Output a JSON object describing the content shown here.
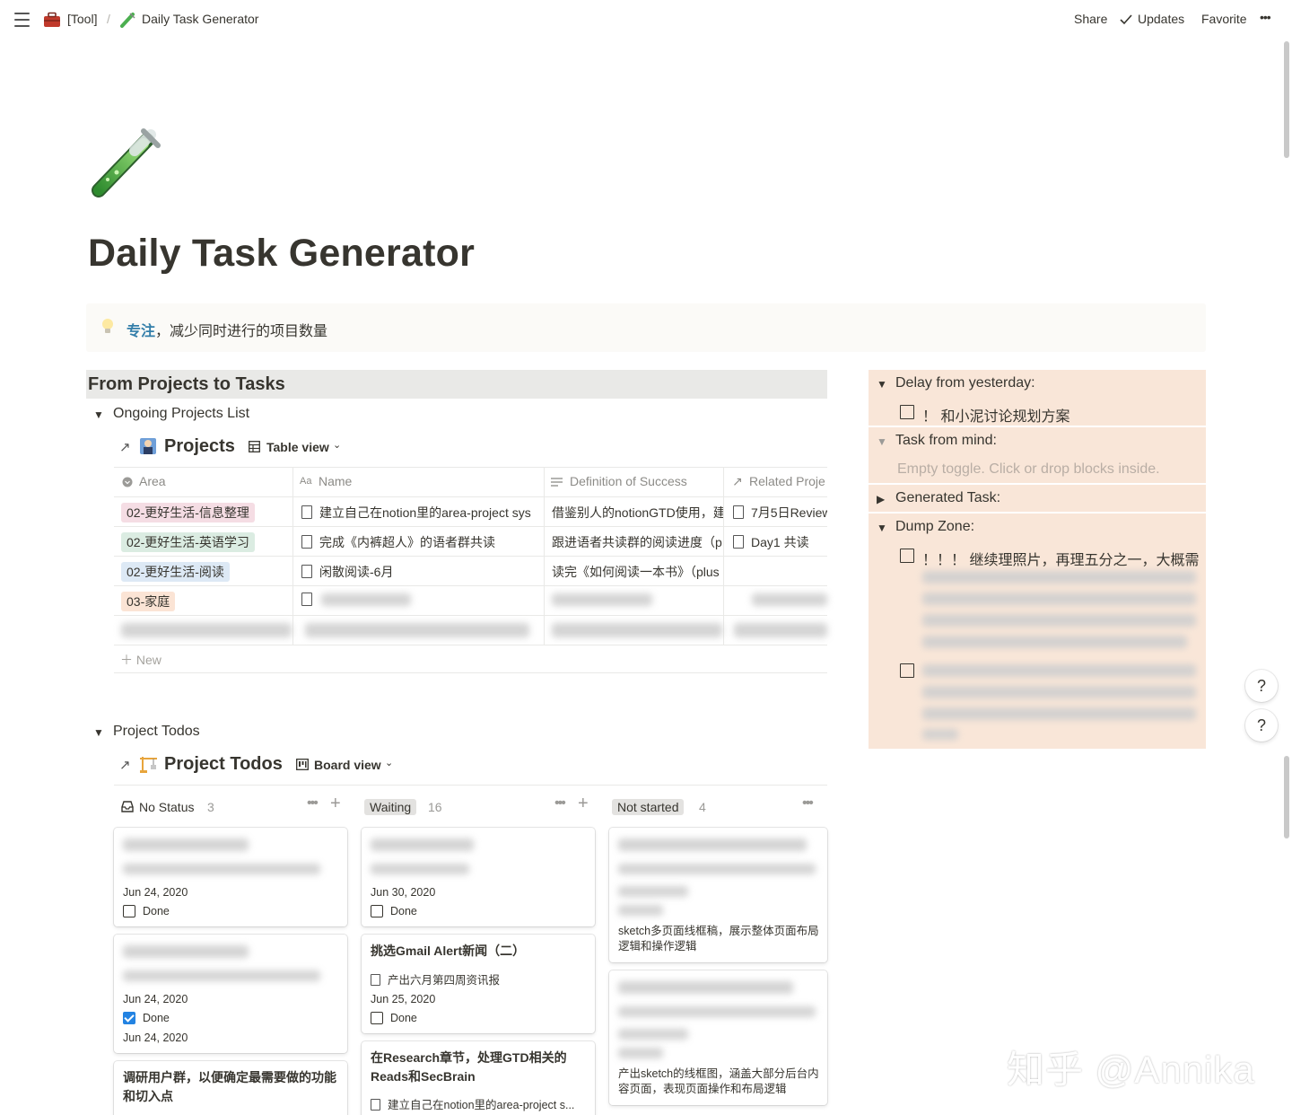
{
  "breadcrumb": {
    "parent": "[Tool]",
    "separator": "/",
    "current": "Daily Task Generator"
  },
  "topbar": {
    "share": "Share",
    "updates": "Updates",
    "favorite": "Favorite",
    "more": "•••"
  },
  "page": {
    "icon": "test-tube-icon",
    "title": "Daily Task Generator"
  },
  "callout": {
    "icon": "lightbulb-icon",
    "emphasis": "专注",
    "text": "，减少同时进行的项目数量"
  },
  "section": {
    "title": "From Projects to Tasks"
  },
  "projects_toggle": {
    "label": "Ongoing Projects List"
  },
  "projects_db": {
    "link_arrow": "↗",
    "title": "Projects",
    "view": "Table view",
    "columns": [
      "Area",
      "Name",
      "Definition of Success",
      "Related Proje"
    ],
    "rows": [
      {
        "area": "02-更好生活-信息整理",
        "area_color": "#f5dde4",
        "name": "建立自己在notion里的area-project sys",
        "success": "借鉴别人的notionGTD使用，建",
        "related": "7月5日Review"
      },
      {
        "area": "02-更好生活-英语学习",
        "area_color": "#dbece2",
        "name": "完成《内裤超人》的语者群共读",
        "success": "跟进语者共读群的阅读进度（p",
        "related": "Day1 共读"
      },
      {
        "area": "02-更好生活-阅读",
        "area_color": "#dde9f5",
        "name": "闲散阅读-6月",
        "success": "读完《如何阅读一本书》（plus",
        "related": ""
      },
      {
        "area": "03-家庭",
        "area_color": "#fbe4d5",
        "name": "",
        "success": "",
        "related": ""
      }
    ],
    "new_label": "New"
  },
  "todos_toggle": {
    "label": "Project Todos"
  },
  "todos_db": {
    "link_arrow": "↗",
    "title": "Project Todos",
    "view": "Board view",
    "groups": [
      {
        "name": "No Status",
        "count": "3"
      },
      {
        "name": "Waiting",
        "count": "16"
      },
      {
        "name": "Not started",
        "count": "4"
      }
    ],
    "cards": {
      "nostatus_1": {
        "date": "Jun 24, 2020",
        "check_label": "Done"
      },
      "nostatus_2": {
        "date": "Jun 24, 2020",
        "check_label": "Done",
        "date2": "Jun 24, 2020"
      },
      "nostatus_3": {
        "title": "调研用户群，以便确定最需要做的功能和切入点"
      },
      "waiting_1": {
        "date": "Jun 30, 2020",
        "check_label": "Done"
      },
      "waiting_2": {
        "title": "挑选Gmail Alert新闻（二）",
        "relation": "产出六月第四周资讯报",
        "date": "Jun 25, 2020",
        "check_label": "Done"
      },
      "waiting_3": {
        "title": "在Research章节，处理GTD相关的Reads和SecBrain",
        "relation": "建立自己在notion里的area-project s..."
      },
      "notstarted_1": {
        "desc": "sketch多页面线框稿，展示整体页面布局逻辑和操作逻辑"
      },
      "notstarted_2": {
        "desc": "产出sketch的线框图，涵盖大部分后台内容页面，表现页面操作和布局逻辑"
      }
    }
  },
  "right_panel": {
    "delay_label": "Delay from yesterday:",
    "delay_item": "！ 和小泥讨论规划方案",
    "mind_label": "Task from mind:",
    "mind_placeholder": "Empty toggle. Click or drop blocks inside.",
    "generated_label": "Generated Task:",
    "dump_label": "Dump Zone:",
    "dump_item": "！！！ 继续理照片，再理五分之一，大概需"
  },
  "help": {
    "label": "?"
  },
  "watermark": "知乎 @Annika"
}
